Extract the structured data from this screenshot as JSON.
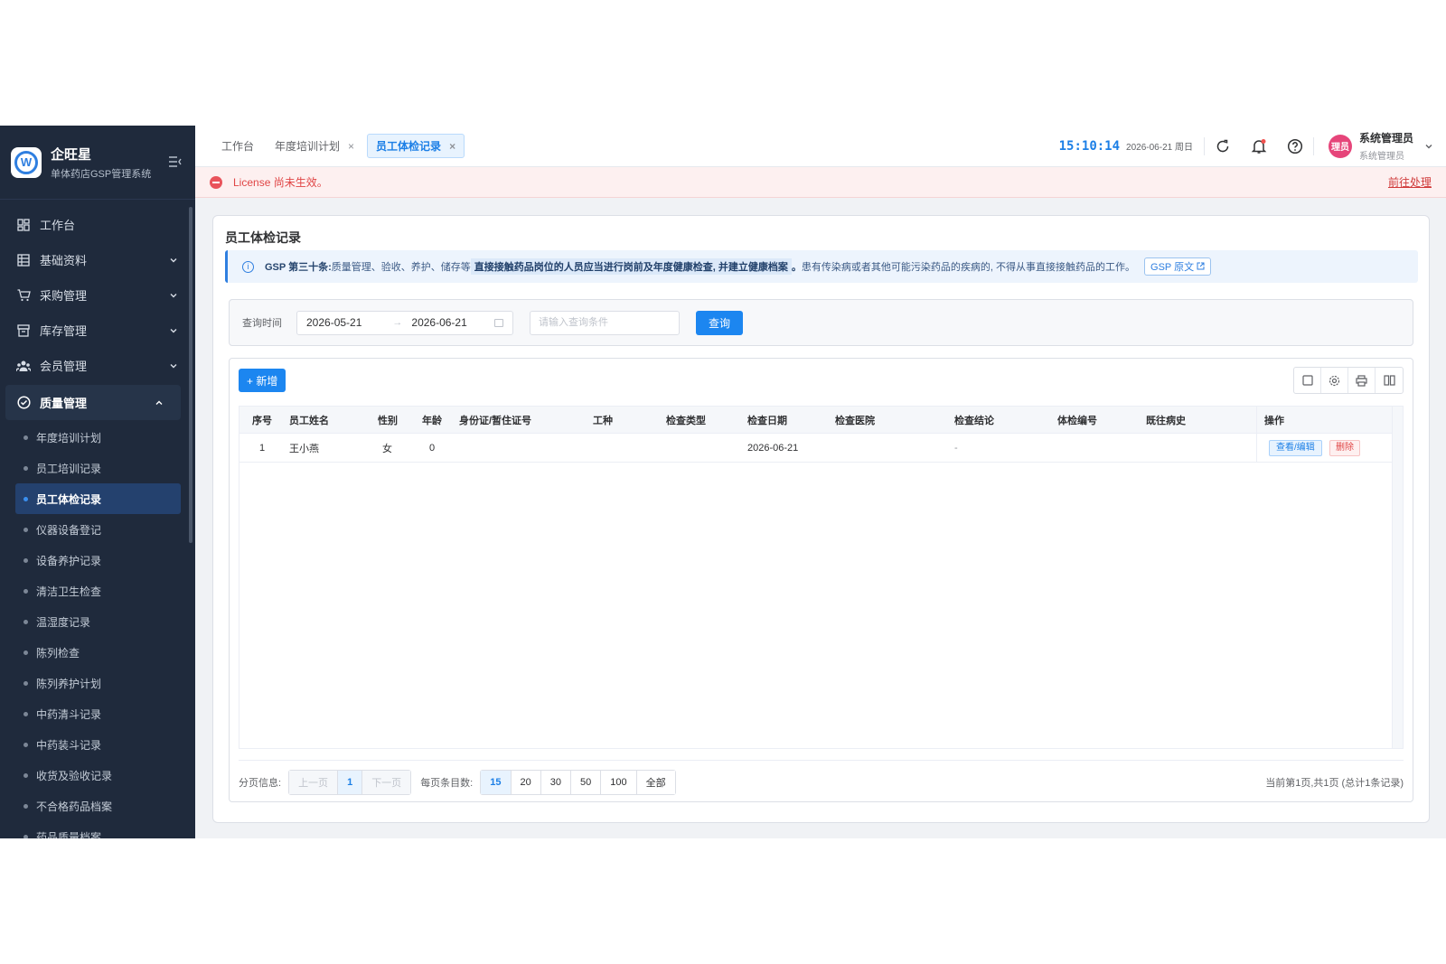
{
  "brand": {
    "name": "企旺星",
    "subtitle": "单体药店GSP管理系统",
    "logo_letter": "W"
  },
  "sidebar": {
    "items": [
      {
        "label": "工作台",
        "icon": "dashboard-icon"
      },
      {
        "label": "基础资料",
        "icon": "grid-icon"
      },
      {
        "label": "采购管理",
        "icon": "cart-icon"
      },
      {
        "label": "库存管理",
        "icon": "box-icon"
      },
      {
        "label": "会员管理",
        "icon": "users-icon"
      },
      {
        "label": "质量管理",
        "icon": "shield-check-icon"
      }
    ],
    "sub_items": [
      "年度培训计划",
      "员工培训记录",
      "员工体检记录",
      "仪器设备登记",
      "设备养护记录",
      "清洁卫生检查",
      "温湿度记录",
      "陈列检查",
      "陈列养护计划",
      "中药清斗记录",
      "中药装斗记录",
      "收货及验收记录",
      "不合格药品档案",
      "药品质量档案"
    ]
  },
  "header": {
    "tabs": [
      {
        "label": "工作台"
      },
      {
        "label": "年度培训计划",
        "close": "×"
      },
      {
        "label": "员工体检记录",
        "close": "×"
      }
    ],
    "time": "15:10:14",
    "date": "2026-06-21 周日",
    "user": {
      "name": "系统管理员",
      "role": "系统管理员",
      "avatar_text": "理员"
    }
  },
  "license": {
    "text": "License 尚未生效。",
    "link": "前往处理"
  },
  "page": {
    "title": "员工体检记录",
    "gsp": {
      "article": "GSP 第三十条:",
      "text1": " 质量管理、验收、养护、储存等 ",
      "highlight": "直接接触药品岗位的人员应当进行岗前及年度健康检查, 并建立健康档案",
      "dot": "。",
      "text2": " 患有传染病或者其他可能污染药品的疾病的, 不得从事直接接触药品的工作。",
      "link": "GSP 原文"
    }
  },
  "query": {
    "label": "查询时间",
    "start": "2026-05-21",
    "arrow": "→",
    "end": "2026-06-21",
    "placeholder": "请输入查询条件",
    "button": "查询"
  },
  "toolbar": {
    "add_label": "+ 新增"
  },
  "table": {
    "columns": [
      "序号",
      "员工姓名",
      "性别",
      "年龄",
      "身份证/暂住证号",
      "工种",
      "检查类型",
      "检查日期",
      "检查医院",
      "检查结论",
      "体检编号",
      "既往病史",
      "操作"
    ],
    "rows": [
      {
        "index": "1",
        "name": "王小燕",
        "gender": "女",
        "age": "0",
        "id_no": "",
        "job": "",
        "type": "",
        "date": "2026-06-21",
        "hospital": "",
        "conclusion": "-",
        "exam_no": "",
        "history": "",
        "edit": "查看/编辑",
        "delete": "删除"
      }
    ]
  },
  "pager": {
    "label": "分页信息:",
    "prev": "上一页",
    "current": "1",
    "next": "下一页",
    "size_label": "每页条目数:",
    "sizes": [
      "15",
      "20",
      "30",
      "50",
      "100",
      "全部"
    ],
    "summary": "当前第1页,共1页 (总计1条记录)"
  },
  "colors": {
    "accent": "#1c86f0",
    "sidebar_bg": "#1f2a3c",
    "danger": "#e04545"
  }
}
